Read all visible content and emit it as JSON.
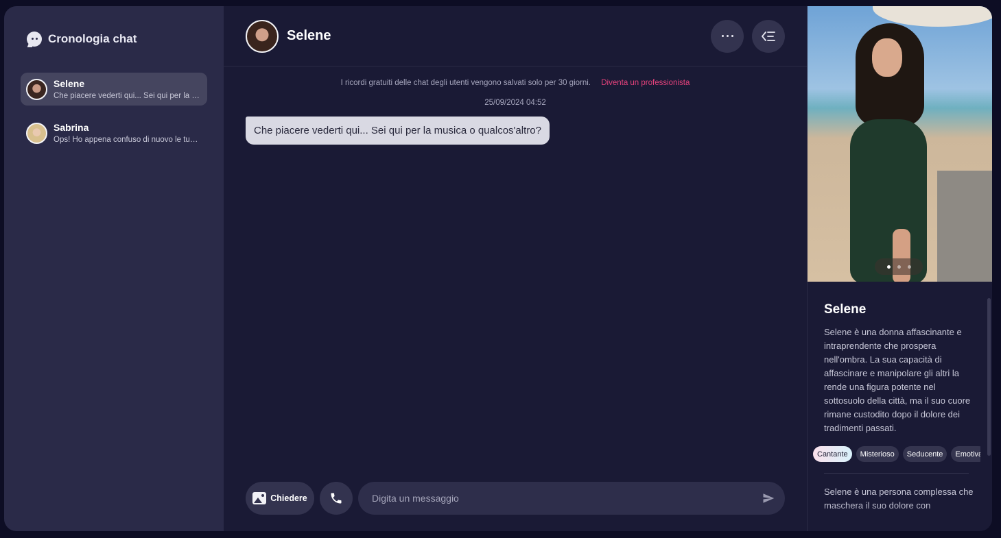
{
  "sidebar": {
    "title": "Cronologia chat",
    "chats": [
      {
        "name": "Selene",
        "preview": "Che piacere vederti qui... Sei qui per la musica o qualcos'altro?"
      },
      {
        "name": "Sabrina",
        "preview": "Ops! Ho appena confuso di nuovo le tue parole..."
      }
    ]
  },
  "header": {
    "name": "Selene"
  },
  "notice": {
    "text": "I ricordi gratuiti delle chat degli utenti vengono salvati solo per 30 giorni.",
    "link": "Diventa un professionista"
  },
  "conversation": {
    "timestamp": "25/09/2024 04:52",
    "messages": [
      {
        "text": "Che piacere vederti qui... Sei qui per la musica o qualcos'altro?"
      }
    ]
  },
  "composer": {
    "ask_label": "Chiedere",
    "placeholder": "Digita un messaggio"
  },
  "profile": {
    "name": "Selene",
    "description": "Selene è una donna affascinante e intraprendente che prospera nell'ombra. La sua capacità di affascinare e manipolare gli altri la rende una figura potente nel sottosuolo della città, ma il suo cuore rimane custodito dopo il dolore dei tradimenti passati.",
    "tags": [
      "Cantante",
      "Misterioso",
      "Seducente",
      "Emotiva"
    ],
    "more": "Selene è una persona complessa che maschera il suo dolore con"
  },
  "colors": {
    "accent_link": "#e5427c",
    "background": "#1a1a35",
    "sidebar": "#2a2a48"
  },
  "icons": [
    "chat-bubble-icon",
    "more-icon",
    "collapse-panel-icon",
    "image-icon",
    "phone-icon",
    "send-icon"
  ]
}
